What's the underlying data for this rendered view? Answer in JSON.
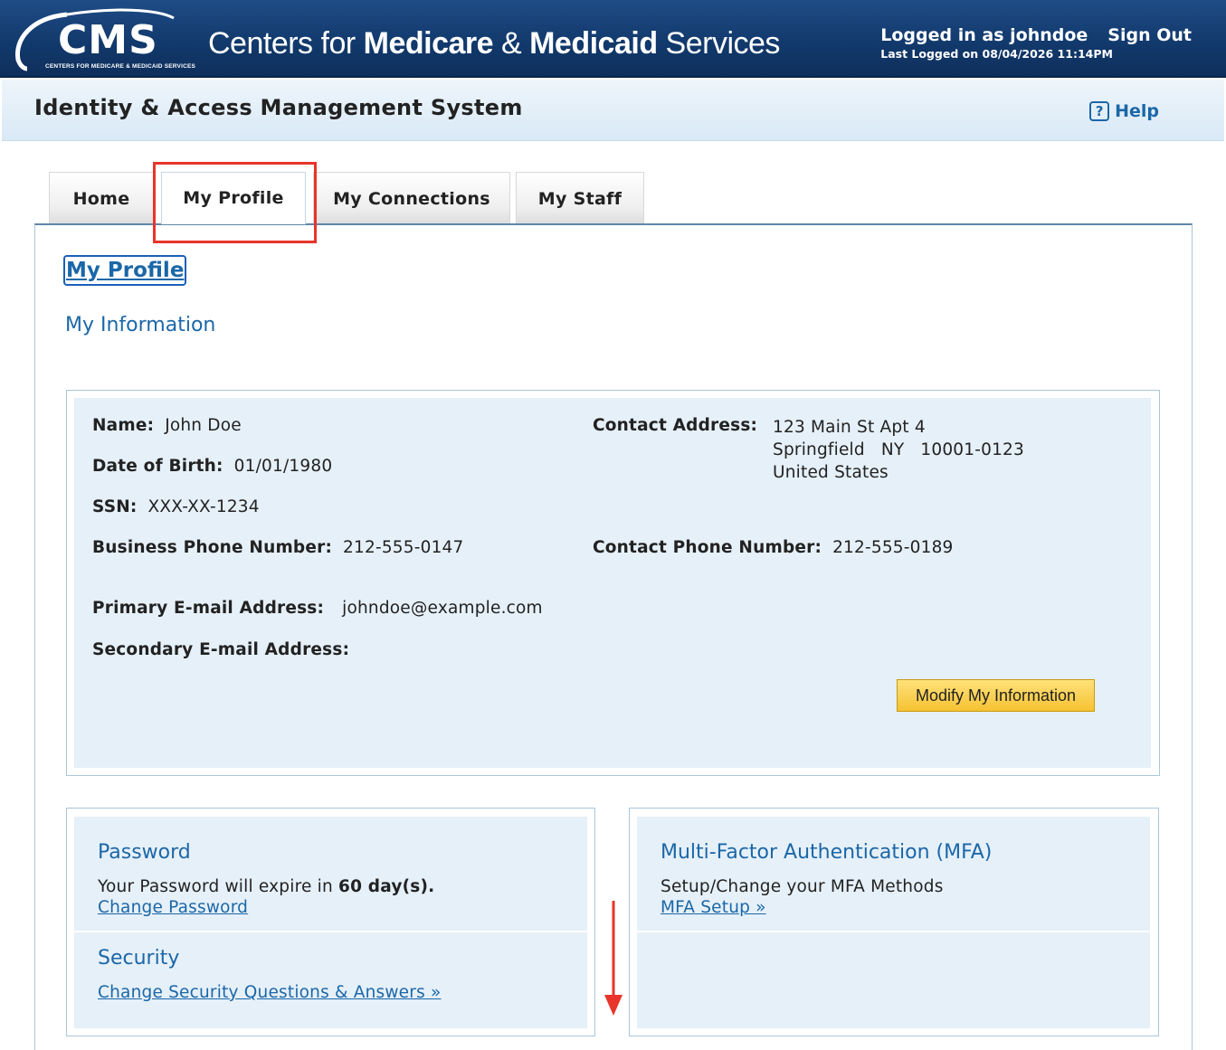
{
  "banner": {
    "logo_text": "CMS",
    "logo_subtext": "CENTERS FOR MEDICARE & MEDICAID SERVICES",
    "agency_prefix": "Centers for ",
    "agency_medicare": "Medicare",
    "agency_amp": " & ",
    "agency_medicaid": "Medicaid",
    "agency_suffix": " Services",
    "logged_in": "Logged in as johndoe",
    "sign_out": "Sign Out",
    "last_logged": "Last Logged on 08/04/2026 11:14PM"
  },
  "subheader": {
    "title": "Identity & Access Management System",
    "help_icon": "?",
    "help": "Help"
  },
  "tabs": [
    {
      "label": "Home"
    },
    {
      "label": "My Profile"
    },
    {
      "label": "My Connections"
    },
    {
      "label": "My Staff"
    }
  ],
  "page": {
    "heading": "My Profile",
    "section_title": "My Information"
  },
  "info": {
    "name_label": "Name:",
    "name": "John Doe",
    "dob_label": "Date of Birth:",
    "dob": "01/01/1980",
    "ssn_label": "SSN:",
    "ssn": "XXX-XX-1234",
    "biz_phone_label": "Business Phone Number:",
    "biz_phone": "212-555-0147",
    "primary_email_label": "Primary E-mail Address:",
    "primary_email": "johndoe@example.com",
    "secondary_email_label": "Secondary E-mail Address:",
    "contact_address_label": "Contact Address:",
    "address_line1": "123 Main St Apt 4",
    "address_city": "Springfield",
    "address_state": "NY",
    "address_zip": "10001-0123",
    "address_country": "United States",
    "contact_phone_label": "Contact Phone Number:",
    "contact_phone": "212-555-0189",
    "modify_button": "Modify My Information"
  },
  "password": {
    "title": "Password",
    "text_prefix": "Your Password will expire in ",
    "days": "60 day(s).",
    "link": "Change Password"
  },
  "security": {
    "title": "Security",
    "link": "Change Security Questions & Answers »"
  },
  "mfa": {
    "title": "Multi-Factor Authentication (MFA)",
    "text": "Setup/Change your MFA Methods",
    "link": "MFA Setup »"
  },
  "colors": {
    "banner": "#123a6d",
    "link": "#1b67a8",
    "panel_bg": "#e6f0f8",
    "button": "#f6c232",
    "highlight": "#e8342a"
  }
}
